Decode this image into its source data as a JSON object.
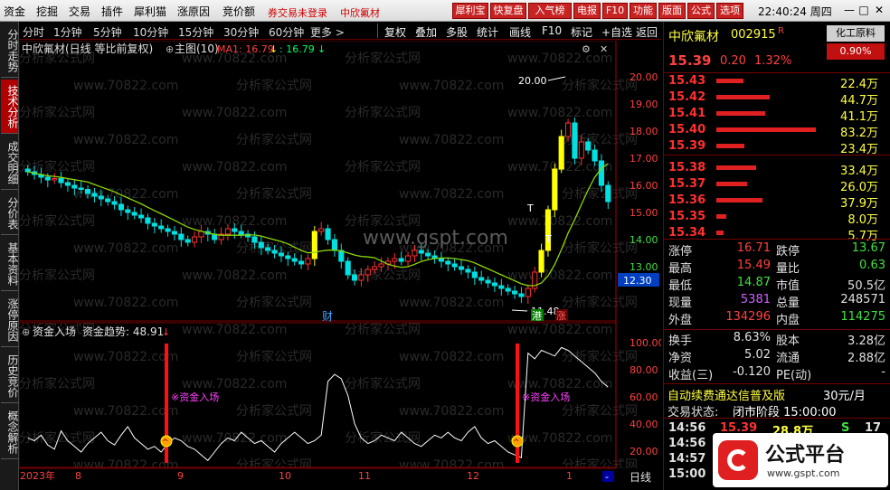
{
  "menu": {
    "items": [
      "资金",
      "挖掘",
      "交易",
      "插件",
      "犀利猫",
      "涨原因",
      "竞价额"
    ],
    "status_red": "券交易未登录",
    "stock_name_red": "中欣氟材"
  },
  "toolbar_buttons": [
    {
      "label": "犀利宝",
      "style": "red"
    },
    {
      "label": "快复盘",
      "style": "red"
    },
    {
      "label": "入气榜",
      "style": "red"
    },
    {
      "label": "电报",
      "style": "red"
    },
    {
      "label": "F10",
      "style": "red"
    },
    {
      "label": "功能",
      "style": "red"
    },
    {
      "label": "版面",
      "style": "red"
    },
    {
      "label": "公式",
      "style": "red"
    },
    {
      "label": "选项",
      "style": "red"
    }
  ],
  "clock": "22:40:24 周四",
  "left_tabs": [
    {
      "label": "分时走势",
      "active": false
    },
    {
      "label": "技术分析",
      "active": true
    },
    {
      "label": "成交明细",
      "active": false
    },
    {
      "label": "分价表",
      "active": false
    },
    {
      "label": "基本资料",
      "active": false
    },
    {
      "label": "涨停原因",
      "active": false
    },
    {
      "label": "历史竞价",
      "active": false
    },
    {
      "label": "概念解析",
      "active": false
    }
  ],
  "periods": [
    "分时",
    "1分钟",
    "5分钟",
    "10分钟",
    "15分钟",
    "30分钟",
    "60分钟",
    "更多 >"
  ],
  "chart_tools": [
    "复权",
    "叠加",
    "多股",
    "统计",
    "画线",
    "F10",
    "标记",
    "+自选",
    "返回"
  ],
  "main_chart": {
    "title": "中欣氟材(日线 等比前复权)",
    "indicator": "主图(10)",
    "ma_label": "MA1: 16.79",
    "ma_label2": ": 16.79",
    "high_label": "20.00",
    "low_label": "11.48",
    "event_cai": "财",
    "event_gang": "港",
    "event_zhang": "涨",
    "t_mark1": "T",
    "t_mark2": "T",
    "axis_ticks": [
      "20.00",
      "19.00",
      "18.00",
      "17.00",
      "16.00",
      "15.00",
      "14.00",
      "13.00"
    ],
    "current_price_tag": "12.30",
    "watermarks": [
      "分析家公式网",
      "www.70822.com"
    ],
    "center_watermark": "www.gspt.com"
  },
  "sub_chart": {
    "title": "资金入场",
    "trend_label": "资金趋势: 48.91",
    "signal_label": "※资金入场",
    "axis_ticks": [
      "100.00",
      "80.00",
      "60.00",
      "40.00",
      "20.00"
    ]
  },
  "time_axis": {
    "labels": [
      "2023年",
      "8",
      "9",
      "10",
      "11",
      "12",
      "1"
    ],
    "period": "日线"
  },
  "quote": {
    "name": "中欣氟材",
    "code": "002915",
    "code_mark": "R",
    "industry": "化工原料",
    "industry_pct": "0.90%",
    "price": "15.39",
    "change": "0.20",
    "change_pct": "1.32%",
    "asks": [
      {
        "price": "15.43",
        "vol": "22.4万",
        "bar": 0.27
      },
      {
        "price": "15.42",
        "vol": "44.7万",
        "bar": 0.54
      },
      {
        "price": "15.41",
        "vol": "41.1万",
        "bar": 0.49
      },
      {
        "price": "15.40",
        "vol": "83.2万",
        "bar": 1.0
      },
      {
        "price": "15.39",
        "vol": "23.4万",
        "bar": 0.28
      }
    ],
    "bids": [
      {
        "price": "15.38",
        "vol": "33.4万",
        "bar": 0.4
      },
      {
        "price": "15.37",
        "vol": "26.0万",
        "bar": 0.31
      },
      {
        "price": "15.36",
        "vol": "37.9万",
        "bar": 0.46
      },
      {
        "price": "15.35",
        "vol": "8.0万",
        "bar": 0.1
      },
      {
        "price": "15.34",
        "vol": "5.7万",
        "bar": 0.07
      }
    ],
    "stats": [
      {
        "l1": "涨停",
        "v1": "16.71",
        "c1": "#ff4040",
        "l2": "跌停",
        "v2": "13.67",
        "c2": "#40e040"
      },
      {
        "l1": "最高",
        "v1": "15.49",
        "c1": "#ff4040",
        "l2": "量比",
        "v2": "0.63",
        "c2": "#40e040"
      },
      {
        "l1": "最低",
        "v1": "14.87",
        "c1": "#40e040",
        "l2": "市值",
        "v2": "50.5亿",
        "c2": "#e0e0e0"
      },
      {
        "l1": "现量",
        "v1": "5381",
        "c1": "#d060ff",
        "l2": "总量",
        "v2": "248571",
        "c2": "#e0e0e0"
      },
      {
        "l1": "外盘",
        "v1": "134296",
        "c1": "#ff4040",
        "l2": "内盘",
        "v2": "114275",
        "c2": "#40e040"
      }
    ],
    "stats2": [
      {
        "l1": "换手",
        "v1": "8.63%",
        "c1": "#e0e0e0",
        "l2": "股本",
        "v2": "3.28亿",
        "c2": "#e0e0e0"
      },
      {
        "l1": "净资",
        "v1": "5.02",
        "c1": "#e0e0e0",
        "l2": "流通",
        "v2": "2.88亿",
        "c2": "#e0e0e0"
      },
      {
        "l1": "收益(三)",
        "v1": "-0.120",
        "c1": "#e0e0e0",
        "l2": "PE(动)",
        "v2": "-",
        "c2": "#e0e0e0"
      }
    ],
    "ad_text": "自动续费通达信普及版",
    "ad_price": "30元/月",
    "trade_state_label": "交易状态:",
    "trade_state": "闭市阶段 15:00:00",
    "ticks": [
      {
        "time": "14:56",
        "price": "15.39",
        "vol": "28.8万",
        "flag": "S",
        "n": "17"
      },
      {
        "time": "14:56",
        "price": "",
        "vol": "",
        "flag": "",
        "n": ""
      },
      {
        "time": "14:57",
        "price": "",
        "vol": "",
        "flag": "",
        "n": ""
      },
      {
        "time": "15:00",
        "price": "",
        "vol": "",
        "flag": "",
        "n": ""
      }
    ],
    "brand": "公式平台",
    "brand_url": "www.gspt.com"
  },
  "colors": {
    "up": "#ff3030",
    "down": "#00e0e0",
    "yellow": "#ffff00",
    "green": "#00ff00",
    "ma": "#ffffff"
  }
}
